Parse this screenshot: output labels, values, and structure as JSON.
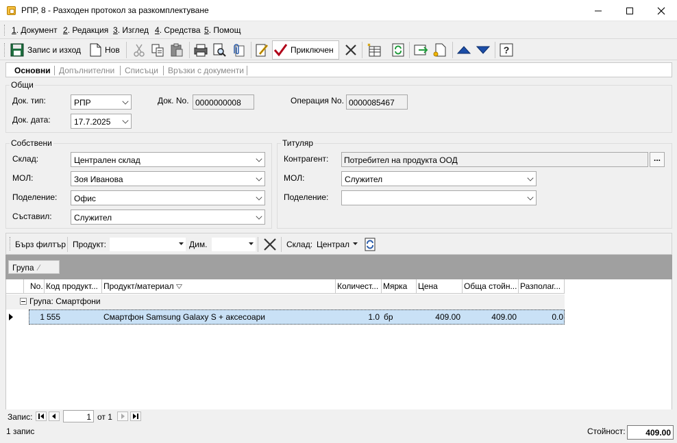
{
  "window": {
    "title": "РПР, 8 - Разходен протокол за разкомплектуване",
    "minimize": "—",
    "maximize": "☐",
    "close": "✕"
  },
  "menu": [
    {
      "key": "1",
      "label": ". Документ"
    },
    {
      "key": "2",
      "label": ". Редакция"
    },
    {
      "key": "3",
      "label": ". Изглед"
    },
    {
      "key": "4",
      "label": ". Средства"
    },
    {
      "key": "5",
      "label": ". Помощ"
    }
  ],
  "toolbar": {
    "save_exit": "Запис и изход",
    "new": "Нов",
    "complete": "Приключен"
  },
  "tabs": [
    "Основни",
    "Допълнителни",
    "Списъци",
    "Връзки с документи"
  ],
  "general": {
    "legend": "Общи",
    "doc_type_label": "Док. тип:",
    "doc_type": "РПР",
    "doc_no_label": "Док. No.",
    "doc_no": "0000000008",
    "op_no_label": "Операция No.",
    "op_no": "0000085467",
    "doc_date_label": "Док. дата:",
    "doc_date": "17.7.2025"
  },
  "own": {
    "legend": "Собствени",
    "warehouse_label": "Склад:",
    "warehouse": "Централен склад",
    "mol_label": "МОЛ:",
    "mol": "Зоя Иванова",
    "division_label": "Поделение:",
    "division": "Офис",
    "author_label": "Съставил:",
    "author": "Служител"
  },
  "holder": {
    "legend": "Титуляр",
    "contractor_label": "Контрагент:",
    "contractor": "Потребител на продукта ООД",
    "browse": "...",
    "mol_label": "МОЛ:",
    "mol": "Служител",
    "division_label": "Поделение:",
    "division": ""
  },
  "filter": {
    "quick": "Бърз филтър",
    "product_label": "Продукт:",
    "product": "",
    "dim_label": "Дим.",
    "dim": "",
    "warehouse_label": "Склад:",
    "warehouse": "Централ"
  },
  "groupby": {
    "label": "Група",
    "sort": "⁄"
  },
  "grid": {
    "columns": [
      "No.",
      "Код продукт...",
      "Продукт/материал",
      "Количест...",
      "Мярка",
      "Цена",
      "Обща стойн...",
      "Разполаг..."
    ],
    "group_row": "Група: Смартфони",
    "rows": [
      {
        "no": "1",
        "code": "555",
        "product": "Смартфон Samsung Galaxy S + аксесоари",
        "qty": "1.0",
        "unit": "бр",
        "price": "409.00",
        "total": "409.00",
        "available": "0.0"
      }
    ]
  },
  "nav": {
    "label": "Запис:",
    "page": "1",
    "of": "от 1"
  },
  "status": {
    "count": "1 запис",
    "value_label": "Стойност:",
    "value": "409.00"
  }
}
